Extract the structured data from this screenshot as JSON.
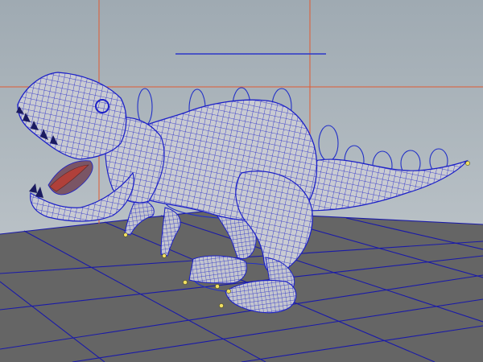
{
  "viewport": {
    "panel": "perspective-viewport",
    "view_mode": "wireframe-on-shaded",
    "subject": "tyrannosaurus-rex-rigged-mesh"
  },
  "colors": {
    "background_top": "#9faab2",
    "background_bottom": "#c7cdd1",
    "ground": "#656565",
    "ground_grid": "#1a1aa8",
    "horizon_grid": "#e05a32",
    "wireframe": "#1c20c8",
    "mesh_shade": "#c9cbd2",
    "rig_controls": "#2230c8",
    "tongue": "#b0403a",
    "locator": "#f2e060"
  }
}
